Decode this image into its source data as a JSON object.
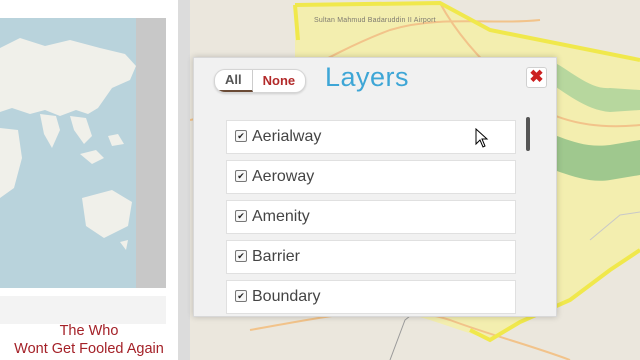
{
  "left_panel": {
    "caption_line1": "The Who",
    "caption_line2": "Wont Get Fooled Again"
  },
  "map": {
    "airport_label": "Sultan Mahmud Badaruddin II Airport"
  },
  "layers_dialog": {
    "title": "Layers",
    "all_label": "All",
    "none_label": "None",
    "close_symbol": "✖",
    "items": [
      {
        "label": "Aerialway",
        "checked": true
      },
      {
        "label": "Aeroway",
        "checked": true
      },
      {
        "label": "Amenity",
        "checked": true
      },
      {
        "label": "Barrier",
        "checked": true
      },
      {
        "label": "Boundary",
        "checked": true
      }
    ],
    "check_symbol": "✔"
  },
  "colors": {
    "title": "#3ea6d6",
    "close": "#cc1f1f",
    "caption": "#a42128",
    "boundary": "#f0e84c",
    "zone_fill": "#f3eeaf",
    "green_area": "#9fc88e"
  },
  "icons": [
    "mouse-pointer-icon",
    "close-icon",
    "checkbox-icon"
  ]
}
